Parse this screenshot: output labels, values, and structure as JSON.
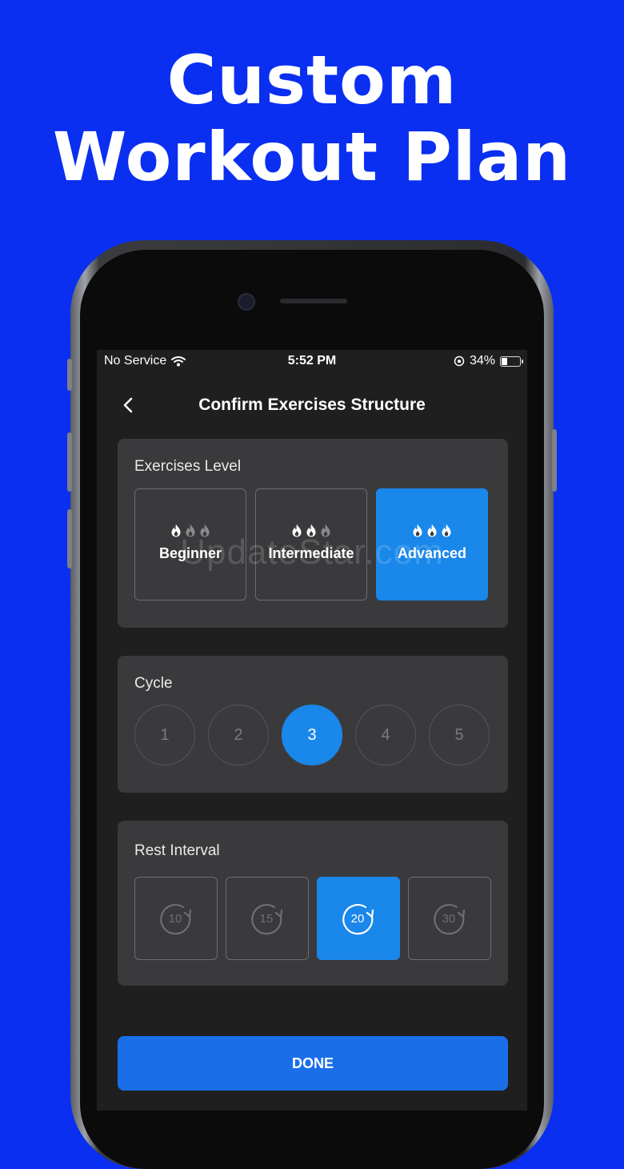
{
  "headline": {
    "line1": "Custom",
    "line2": "Workout Plan"
  },
  "status_bar": {
    "carrier": "No Service",
    "time": "5:52 PM",
    "battery": "34%",
    "battery_fraction": 0.34
  },
  "nav": {
    "title": "Confirm Exercises Structure",
    "back_icon": "chevron-left-icon"
  },
  "exercises_level": {
    "label": "Exercises Level",
    "options": [
      {
        "name": "Beginner",
        "flames_active": 1,
        "selected": false
      },
      {
        "name": "Intermediate",
        "flames_active": 2,
        "selected": false
      },
      {
        "name": "Advanced",
        "flames_active": 3,
        "selected": true
      }
    ]
  },
  "cycle": {
    "label": "Cycle",
    "options": [
      "1",
      "2",
      "3",
      "4",
      "5"
    ],
    "selected": "3"
  },
  "rest_interval": {
    "label": "Rest Interval",
    "options": [
      "10",
      "15",
      "20",
      "30"
    ],
    "selected": "20",
    "icon": "timer-restart-icon"
  },
  "done_button": {
    "label": "DONE"
  },
  "watermark": "UpdateStar.com",
  "colors": {
    "background": "#0a2ff0",
    "accent": "#1a87ea",
    "button": "#1a6fe8",
    "card": "#3a3a3c",
    "screen": "#1f1f20"
  }
}
